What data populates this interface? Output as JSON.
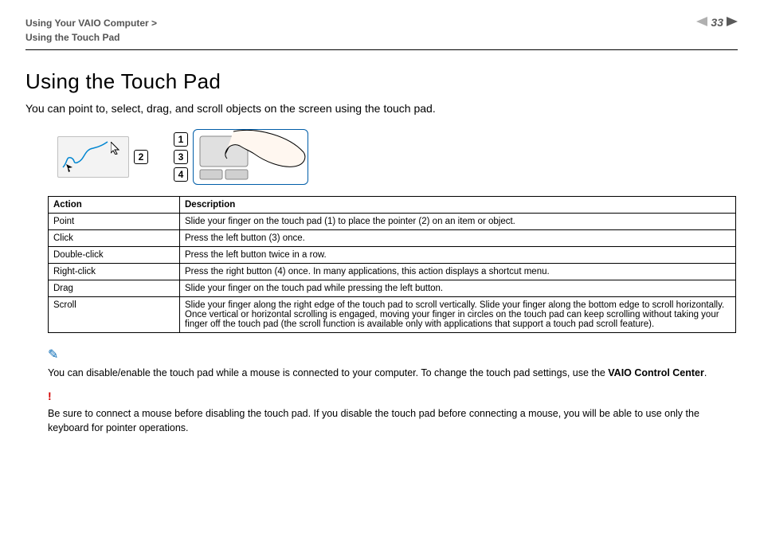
{
  "header": {
    "breadcrumb_line1": "Using Your VAIO Computer >",
    "breadcrumb_line2": "Using the Touch Pad",
    "page_number": "33"
  },
  "title": "Using the Touch Pad",
  "intro": "You can point to, select, drag, and scroll objects on the screen using the touch pad.",
  "figure": {
    "callout_2": "2",
    "callout_1": "1",
    "callout_3": "3",
    "callout_4": "4"
  },
  "table": {
    "head_action": "Action",
    "head_desc": "Description",
    "rows": [
      {
        "action": "Point",
        "desc": "Slide your finger on the touch pad (1) to place the pointer (2) on an item or object."
      },
      {
        "action": "Click",
        "desc": "Press the left button (3) once."
      },
      {
        "action": "Double-click",
        "desc": "Press the left button twice in a row."
      },
      {
        "action": "Right-click",
        "desc": "Press the right button (4) once. In many applications, this action displays a shortcut menu."
      },
      {
        "action": "Drag",
        "desc": "Slide your finger on the touch pad while pressing the left button."
      },
      {
        "action": "Scroll",
        "desc": "Slide your finger along the right edge of the touch pad to scroll vertically. Slide your finger along the bottom edge to scroll horizontally. Once vertical or horizontal scrolling is engaged, moving your finger in circles on the touch pad can keep scrolling without taking your finger off the touch pad (the scroll function is available only with applications that support a touch pad scroll feature)."
      }
    ]
  },
  "note": {
    "icon": "✎",
    "text_before": "You can disable/enable the touch pad while a mouse is connected to your computer. To change the touch pad settings, use the ",
    "bold": "VAIO Control Center",
    "text_after": "."
  },
  "alert": {
    "icon": "!",
    "text": "Be sure to connect a mouse before disabling the touch pad. If you disable the touch pad before connecting a mouse, you will be able to use only the keyboard for pointer operations."
  }
}
